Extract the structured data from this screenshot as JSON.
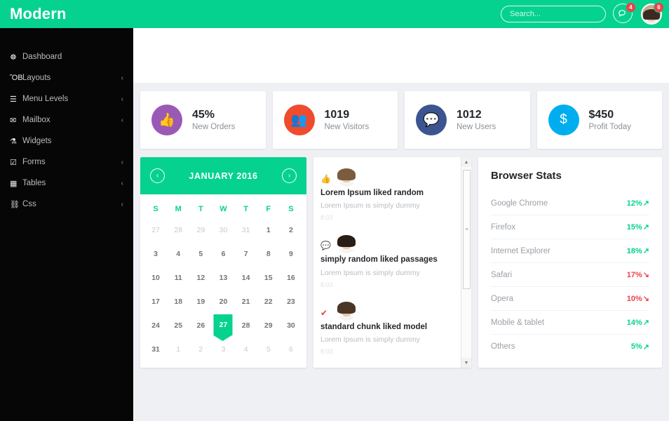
{
  "brand": {
    "name": "Modern"
  },
  "topbar": {
    "search": {
      "placeholder": "Search...",
      "value": ""
    },
    "messages": {
      "icon": "chat-bubble-icon",
      "badge": "4"
    },
    "profile": {
      "icon": "avatar",
      "badge": "6"
    }
  },
  "sidebar": {
    "items": [
      {
        "label": "Dashboard",
        "icon": "dashboard-icon",
        "glyph": "☸",
        "caret": ""
      },
      {
        "label": "Layouts",
        "icon": "layouts-icon",
        "glyph": "ὋB",
        "caret": "‹"
      },
      {
        "label": "Menu Levels",
        "icon": "menu-levels-icon",
        "glyph": "☰",
        "caret": "‹"
      },
      {
        "label": "Mailbox",
        "icon": "mail-icon",
        "glyph": "✉",
        "caret": "‹"
      },
      {
        "label": "Widgets",
        "icon": "widgets-icon",
        "glyph": "⚗",
        "caret": ""
      },
      {
        "label": "Forms",
        "icon": "forms-icon",
        "glyph": "☑",
        "caret": "‹"
      },
      {
        "label": "Tables",
        "icon": "tables-icon",
        "glyph": "▦",
        "caret": "‹"
      },
      {
        "label": "Css",
        "icon": "css-icon",
        "glyph": "⛓",
        "caret": "‹"
      }
    ]
  },
  "stats": [
    {
      "value": "45%",
      "label": "New Orders",
      "icon": "thumbs-up-icon",
      "glyph": "👍",
      "color": "#9b59b6"
    },
    {
      "value": "1019",
      "label": "New Visitors",
      "icon": "users-icon",
      "glyph": "👥",
      "color": "#ef4b2d"
    },
    {
      "value": "1012",
      "label": "New Users",
      "icon": "comment-icon",
      "glyph": "💬",
      "color": "#3c5590"
    },
    {
      "value": "$450",
      "label": "Profit Today",
      "icon": "dollar-icon",
      "glyph": "$",
      "color": "#00aeef"
    }
  ],
  "calendar": {
    "title": "JANUARY 2016",
    "prev_icon": "chevron-left-icon",
    "next_icon": "chevron-right-icon",
    "prev_glyph": "‹",
    "next_glyph": "›",
    "dow": [
      "S",
      "M",
      "T",
      "W",
      "T",
      "F",
      "S"
    ],
    "today": "27",
    "weeks": [
      [
        {
          "d": "27",
          "m": true
        },
        {
          "d": "28",
          "m": true
        },
        {
          "d": "29",
          "m": true
        },
        {
          "d": "30",
          "m": true
        },
        {
          "d": "31",
          "m": true
        },
        {
          "d": "1",
          "m": false
        },
        {
          "d": "2",
          "m": false
        }
      ],
      [
        {
          "d": "3",
          "m": false
        },
        {
          "d": "4",
          "m": false
        },
        {
          "d": "5",
          "m": false
        },
        {
          "d": "6",
          "m": false
        },
        {
          "d": "7",
          "m": false
        },
        {
          "d": "8",
          "m": false
        },
        {
          "d": "9",
          "m": false
        }
      ],
      [
        {
          "d": "10",
          "m": false
        },
        {
          "d": "11",
          "m": false
        },
        {
          "d": "12",
          "m": false
        },
        {
          "d": "13",
          "m": false
        },
        {
          "d": "14",
          "m": false
        },
        {
          "d": "15",
          "m": false
        },
        {
          "d": "16",
          "m": false
        }
      ],
      [
        {
          "d": "17",
          "m": false
        },
        {
          "d": "18",
          "m": false
        },
        {
          "d": "19",
          "m": false
        },
        {
          "d": "20",
          "m": false
        },
        {
          "d": "21",
          "m": false
        },
        {
          "d": "22",
          "m": false
        },
        {
          "d": "23",
          "m": false
        }
      ],
      [
        {
          "d": "24",
          "m": false
        },
        {
          "d": "25",
          "m": false
        },
        {
          "d": "26",
          "m": false
        },
        {
          "d": "27",
          "m": false
        },
        {
          "d": "28",
          "m": false
        },
        {
          "d": "29",
          "m": false
        },
        {
          "d": "30",
          "m": false
        }
      ],
      [
        {
          "d": "31",
          "m": false
        },
        {
          "d": "1",
          "m": true
        },
        {
          "d": "2",
          "m": true
        },
        {
          "d": "3",
          "m": true
        },
        {
          "d": "4",
          "m": true
        },
        {
          "d": "5",
          "m": true
        },
        {
          "d": "6",
          "m": true
        }
      ]
    ]
  },
  "feed": {
    "items": [
      {
        "icon": "thumbs-up-icon",
        "glyph": "👍",
        "icon_color": "#2d7fd3",
        "title": "Lorem Ipsum liked random",
        "subtitle": "Lorem Ipsum is simply dummy",
        "time": "8:03",
        "hair": "#7a5c3e"
      },
      {
        "icon": "comment-icon",
        "glyph": "💬",
        "icon_color": "#2d7fd3",
        "title": "simply random liked passages",
        "subtitle": "Lorem Ipsum is simply dummy",
        "time": "8:03",
        "hair": "#2a1d16"
      },
      {
        "icon": "check-icon",
        "glyph": "✔",
        "icon_color": "#e8414c",
        "title": "standard chunk liked model",
        "subtitle": "Lorem Ipsum is simply dummy",
        "time": "8:03",
        "hair": "#4a3626"
      }
    ],
    "scrollbar": {
      "up_glyph": "▲",
      "down_glyph": "▼",
      "grip": "≡"
    }
  },
  "browser_stats": {
    "title": "Browser Stats",
    "up_glyph": "↗",
    "down_glyph": "↘",
    "rows": [
      {
        "name": "Google Chrome",
        "value": "12%",
        "dir": "up"
      },
      {
        "name": "Firefox",
        "value": "15%",
        "dir": "up"
      },
      {
        "name": "Internet Explorer",
        "value": "18%",
        "dir": "up"
      },
      {
        "name": "Safari",
        "value": "17%",
        "dir": "down"
      },
      {
        "name": "Opera",
        "value": "10%",
        "dir": "down"
      },
      {
        "name": "Mobile & tablet",
        "value": "14%",
        "dir": "up"
      },
      {
        "name": "Others",
        "value": "5%",
        "dir": "up"
      }
    ]
  },
  "colors": {
    "brand_green": "#05d28e",
    "badge_red": "#f0404a",
    "sidebar_bg": "#060606",
    "page_bg": "#eff0f4"
  }
}
